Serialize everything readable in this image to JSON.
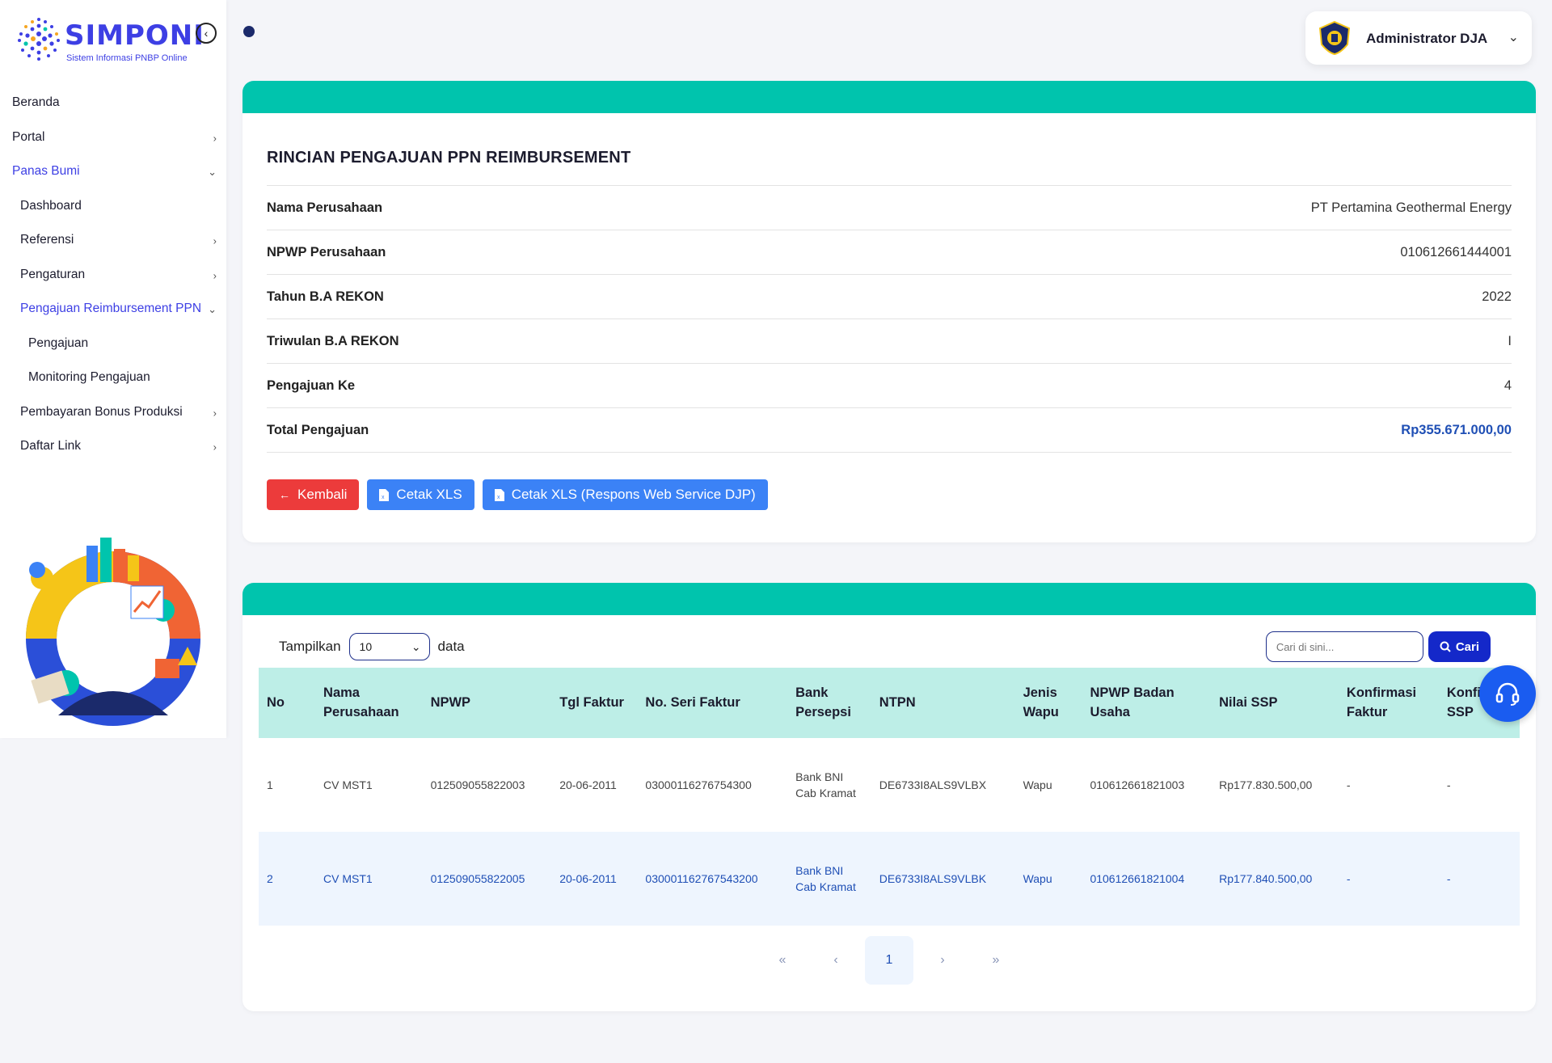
{
  "app": {
    "logo_title": "SIMPONI",
    "logo_subtitle": "Sistem Informasi PNBP Online"
  },
  "sidebar": {
    "items": [
      {
        "label": "Beranda",
        "level": 1,
        "chevron": "",
        "active": false
      },
      {
        "label": "Portal",
        "level": 1,
        "chevron": "›",
        "active": false
      },
      {
        "label": "Panas Bumi",
        "level": 1,
        "chevron": "⌄",
        "active": true
      },
      {
        "label": "Dashboard",
        "level": 2,
        "chevron": "",
        "active": false
      },
      {
        "label": "Referensi",
        "level": 2,
        "chevron": "›",
        "active": false
      },
      {
        "label": "Pengaturan",
        "level": 2,
        "chevron": "›",
        "active": false
      },
      {
        "label": "Pengajuan Reimbursement PPN",
        "level": 2,
        "chevron": "⌄",
        "active": true
      },
      {
        "label": "Pengajuan",
        "level": 3,
        "chevron": "",
        "active": false
      },
      {
        "label": "Monitoring Pengajuan",
        "level": 3,
        "chevron": "",
        "active": false
      },
      {
        "label": "Pembayaran Bonus Produksi",
        "level": 2,
        "chevron": "›",
        "active": false
      },
      {
        "label": "Daftar Link",
        "level": 2,
        "chevron": "›",
        "active": false
      }
    ]
  },
  "user": {
    "name": "Administrator DJA"
  },
  "detail": {
    "title": "RINCIAN PENGAJUAN PPN REIMBURSEMENT",
    "rows": [
      {
        "label": "Nama Perusahaan",
        "value": "PT Pertamina Geothermal Energy"
      },
      {
        "label": "NPWP Perusahaan",
        "value": "010612661444001"
      },
      {
        "label": "Tahun B.A REKON",
        "value": "2022"
      },
      {
        "label": "Triwulan B.A REKON",
        "value": "I"
      },
      {
        "label": "Pengajuan Ke",
        "value": "4"
      },
      {
        "label": "Total Pengajuan",
        "value": "Rp355.671.000,00"
      }
    ],
    "buttons": {
      "back": "Kembali",
      "print_xls": "Cetak XLS",
      "print_xls_djp": "Cetak XLS (Respons Web Service DJP)"
    }
  },
  "table": {
    "show_label": "Tampilkan",
    "page_size": "10",
    "data_label": "data",
    "search_placeholder": "Cari di sini...",
    "search_button": "Cari",
    "headers": [
      "No",
      "Nama Perusahaan",
      "NPWP",
      "Tgl Faktur",
      "No. Seri Faktur",
      "Bank Persepsi",
      "NTPN",
      "Jenis Wapu",
      "NPWP Badan Usaha",
      "Nilai SSP",
      "Konfirmasi Faktur",
      "Konfirmasi SSP"
    ],
    "rows": [
      [
        "1",
        "CV MST1",
        "012509055822003",
        "20-06-2011",
        "030001162767543​00",
        "Bank BNI Cab Kramat",
        "DE6733I8ALS9VLBX",
        "Wapu",
        "010612661821003",
        "Rp177.830.500,00",
        "-",
        "-"
      ],
      [
        "2",
        "CV MST1",
        "012509055822005",
        "20-06-2011",
        "030001162767543200",
        "Bank BNI Cab Kramat",
        "DE6733I8ALS9VLBK",
        "Wapu",
        "010612661821004",
        "Rp177.840.500,00",
        "-",
        "-"
      ]
    ],
    "pagination": {
      "first": "«",
      "prev": "‹",
      "current": "1",
      "next": "›",
      "last": "»"
    }
  },
  "colors": {
    "accent": "#3d3fe4",
    "band": "#00c4ad",
    "danger": "#ec3b3b",
    "primary": "#3b82f6",
    "search_button": "#1428c9",
    "table_header": "#bdeee7"
  }
}
